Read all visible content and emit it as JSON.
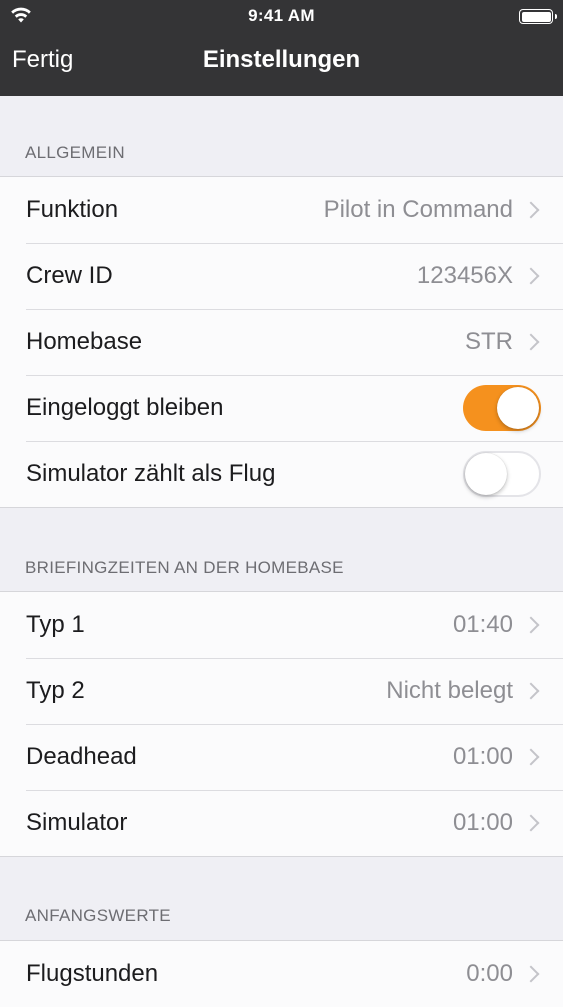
{
  "status_bar": {
    "time": "9:41 AM",
    "icons": [
      "wifi-icon",
      "battery-icon"
    ]
  },
  "nav": {
    "done_label": "Fertig",
    "title": "Einstellungen"
  },
  "colors": {
    "accent": "#f5911e",
    "nav_bg": "#343436",
    "background": "#efeff4"
  },
  "sections": [
    {
      "header": "ALLGEMEIN",
      "rows": [
        {
          "label": "Funktion",
          "value": "Pilot in Command"
        },
        {
          "label": "Crew ID",
          "value": "123456X"
        },
        {
          "label": "Homebase",
          "value": "STR"
        },
        {
          "label": "Eingeloggt bleiben",
          "toggle": true
        },
        {
          "label": "Simulator zählt als Flug",
          "toggle": false
        }
      ]
    },
    {
      "header": "BRIEFINGZEITEN AN DER HOMEBASE",
      "rows": [
        {
          "label": "Typ 1",
          "value": "01:40"
        },
        {
          "label": "Typ 2",
          "value": "Nicht belegt"
        },
        {
          "label": "Deadhead",
          "value": "01:00"
        },
        {
          "label": "Simulator",
          "value": "01:00"
        }
      ]
    },
    {
      "header": "ANFANGSWERTE",
      "rows": [
        {
          "label": "Flugstunden",
          "value": "0:00"
        }
      ]
    }
  ]
}
